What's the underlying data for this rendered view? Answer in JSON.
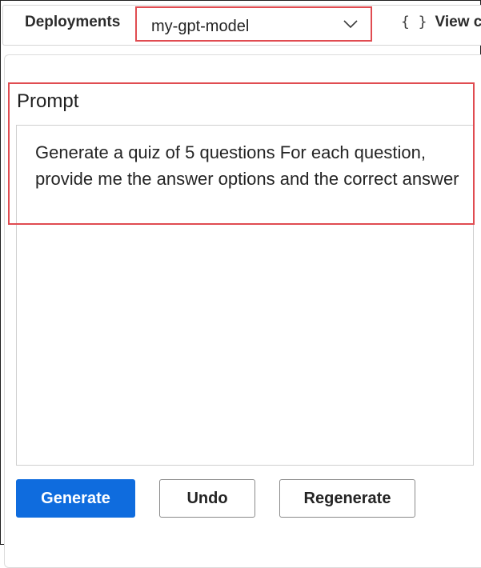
{
  "toolbar": {
    "deployments_label": "Deployments",
    "deployment_value": "my-gpt-model",
    "view_code_icon": "{ }",
    "view_code_label": "View c"
  },
  "prompt": {
    "title": "Prompt",
    "text": "Generate a quiz of 5 questions For each question, provide me the answer options and the correct answer"
  },
  "actions": {
    "generate_label": "Generate",
    "undo_label": "Undo",
    "regenerate_label": "Regenerate"
  },
  "colors": {
    "accent": "#0f6cde",
    "highlight": "#e04c51"
  }
}
